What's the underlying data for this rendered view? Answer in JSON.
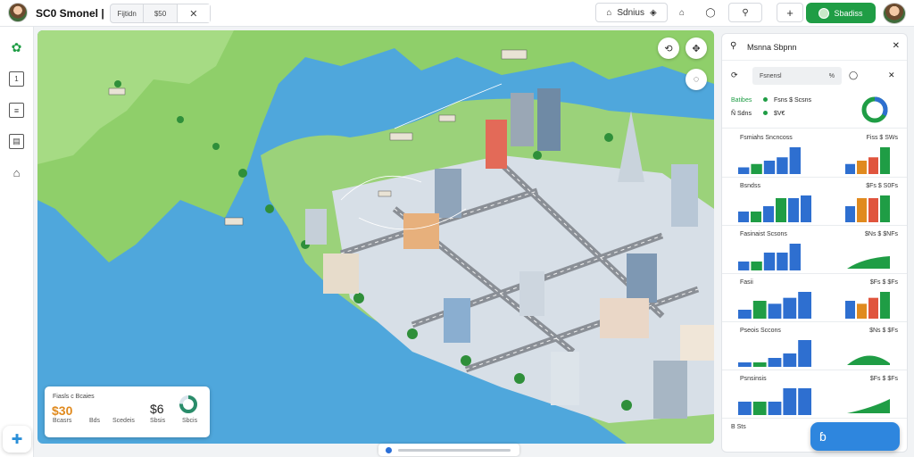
{
  "app": {
    "title": "SC0 Smonel |"
  },
  "topbar": {
    "segments": [
      "Fijtidn",
      "$50",
      "✕"
    ],
    "location_label": "Sdnius",
    "add_label": "+",
    "primary_label": "Sbadiss"
  },
  "left_rail": {
    "icons": [
      "map-pin-icon",
      "document-icon",
      "checklist-icon",
      "clipboard-icon",
      "settings-icon"
    ]
  },
  "map": {
    "controls": [
      "share-icon",
      "fullscreen-icon",
      "chat-icon"
    ],
    "summary_card": {
      "title": "Fiasls c Bcaies",
      "value_a": "$30",
      "value_b": "$6",
      "ring_label": "Sbcis",
      "row_labels": [
        "Bcasrs",
        "Bds",
        "Scedeis",
        "Sbsis"
      ]
    }
  },
  "panel": {
    "search_placeholder": "Msnna Sbpnn",
    "tab_label": "Fsnensl",
    "tab_value": "%",
    "stats": [
      {
        "label": "Batibes",
        "value": "Fsns $ Scsns"
      },
      {
        "label": "Ñ Sdns",
        "value": "$V€"
      }
    ],
    "sections": [
      {
        "title": "Fsmiahs Sncncoss",
        "right": "Fiss $ SWs"
      },
      {
        "title": "Bsndss",
        "right": "$Fs $ S0Fs"
      },
      {
        "title": "Fasinaist Scsons",
        "right": "$Ns $ $NFs"
      },
      {
        "title": "Fasii",
        "right": "$Fs $ $Fs"
      },
      {
        "title": "Pseois Sccons",
        "right": "$Ns $ $Fs"
      },
      {
        "title": "Psnsinsis",
        "right": "$Fs $ $Fs"
      },
      {
        "title": "B Sts",
        "right": ""
      }
    ],
    "fab_label": "ɓ"
  },
  "colors": {
    "accent": "#2e86de",
    "brand_green": "#1f9d45",
    "water": "#4fa7dc",
    "land": "#9bd27a"
  },
  "chart_data": [
    {
      "type": "bar",
      "title": "Fsmiahs Sncncoss",
      "series": [
        {
          "values": [
            2,
            3,
            4,
            5,
            8
          ]
        }
      ]
    },
    {
      "type": "bar",
      "title": "Bsndss",
      "series": [
        {
          "values": [
            4,
            4,
            6,
            9,
            9,
            10
          ]
        }
      ]
    },
    {
      "type": "bar",
      "title": "Fasinaist Scsons",
      "series": [
        {
          "values": [
            1,
            1,
            2,
            2,
            3
          ]
        }
      ]
    },
    {
      "type": "bar",
      "title": "Fasii",
      "series": [
        {
          "values": [
            3,
            6,
            5,
            7,
            9
          ]
        }
      ]
    },
    {
      "type": "bar",
      "title": "Pseois Sccons",
      "series": [
        {
          "values": [
            1,
            1,
            2,
            3,
            6
          ]
        }
      ]
    },
    {
      "type": "bar",
      "title": "Psnsinsis",
      "series": [
        {
          "values": [
            1,
            1,
            1,
            2,
            2
          ]
        }
      ]
    }
  ]
}
